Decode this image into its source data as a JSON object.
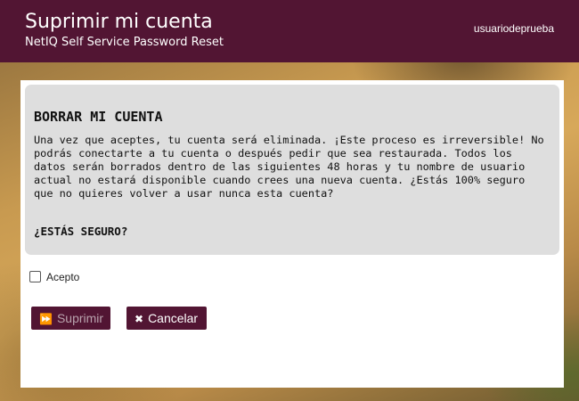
{
  "header": {
    "title": "Suprimir mi cuenta",
    "subtitle": "NetIQ Self Service Password Reset",
    "username": "usuariodeprueba"
  },
  "warning": {
    "heading": "BORRAR MI CUENTA",
    "body": "Una vez que aceptes, tu cuenta será eliminada. ¡Este proceso es irreversible! No\npodrás conectarte a tu cuenta o después pedir que sea restaurada. Todos los\ndatos serán borrados dentro de las siguientes 48 horas y tu nombre de usuario\nactual no estará disponible cuando crees una nueva cuenta. ¿Estás 100% seguro\nque no quieres volver a usar nunca esta cuenta?",
    "question": "¿ESTÁS SEGURO?"
  },
  "form": {
    "accept_label": "Acepto",
    "accept_checked": false
  },
  "buttons": {
    "delete_label": "Suprimir",
    "delete_icon": "fast-forward-icon",
    "delete_disabled": true,
    "cancel_label": "Cancelar",
    "cancel_icon": "close-icon"
  },
  "colors": {
    "brand": "#521533",
    "warning_bg": "#dedede"
  }
}
